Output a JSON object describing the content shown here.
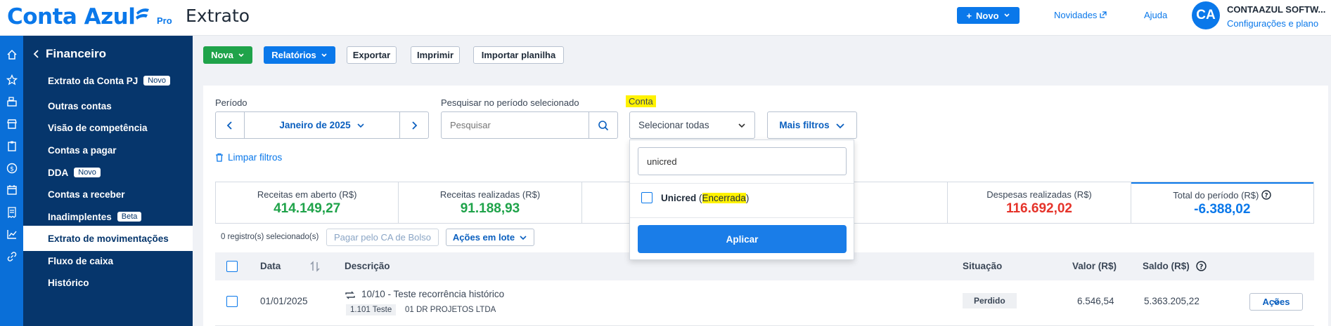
{
  "header": {
    "logo_text": "Conta Azul",
    "logo_badge": "Pro",
    "page_title": "Extrato",
    "new_button": "Novo",
    "news_link": "Novidades",
    "help_link": "Ajuda",
    "avatar_initials": "CA",
    "company_name": "CONTAAZUL SOFTW...",
    "settings_link": "Configurações e plano"
  },
  "sidebar": {
    "title": "Financeiro",
    "items": [
      {
        "label": "Extrato da Conta PJ",
        "badge": "Novo"
      },
      {
        "label": "Outras contas"
      },
      {
        "label": "Visão de competência"
      },
      {
        "label": "Contas a pagar"
      },
      {
        "label": "DDA",
        "badge": "Novo"
      },
      {
        "label": "Contas a receber"
      },
      {
        "label": "Inadimplentes",
        "badge": "Beta"
      },
      {
        "label": "Extrato de movimentações",
        "active": true
      },
      {
        "label": "Fluxo de caixa"
      },
      {
        "label": "Histórico"
      }
    ],
    "icons": [
      "home-icon",
      "star-icon",
      "cash-register-icon",
      "store-icon",
      "clipboard-icon",
      "dollar-icon",
      "calendar-icon",
      "receipt-icon",
      "chart-line-icon",
      "link-icon"
    ]
  },
  "toolbar": {
    "nova": "Nova",
    "relatorios": "Relatórios",
    "exportar": "Exportar",
    "imprimir": "Imprimir",
    "importar": "Importar planilha"
  },
  "filters": {
    "period_label": "Período",
    "period_value": "Janeiro de 2025",
    "search_label": "Pesquisar no período selecionado",
    "search_placeholder": "Pesquisar",
    "account_label": "Conta",
    "account_value": "Selecionar todas",
    "more_filters": "Mais filtros",
    "clear_filters": "Limpar filtros"
  },
  "dropdown": {
    "search_value": "unicred",
    "option_name": "Unicred",
    "option_paren_open": "(",
    "option_status": "Encerrada",
    "option_paren_close": ")",
    "apply": "Aplicar"
  },
  "summary": [
    {
      "label": "Receitas em aberto (R$)",
      "value": "414.149,27",
      "color": "#1fa34a"
    },
    {
      "label": "Receitas realizadas (R$)",
      "value": "91.188,93",
      "color": "#1fa34a"
    },
    {
      "label": "",
      "value": ""
    },
    {
      "label": "",
      "value": ""
    },
    {
      "label": "Despesas realizadas (R$)",
      "value": "116.692,02",
      "color": "#e5332a"
    },
    {
      "label": "Total do período (R$)",
      "value": "-6.388,02",
      "color": "#0a78ea"
    }
  ],
  "table_actions": {
    "selected_count": "0 registro(s) selecionado(s)",
    "pay_button": "Pagar pelo CA de Bolso",
    "batch_actions": "Ações em lote"
  },
  "table": {
    "columns": [
      "Data",
      "Descrição",
      "Situação",
      "Valor (R$)",
      "Saldo (R$)"
    ],
    "rows": [
      {
        "date": "01/01/2025",
        "description": "10/10 - Teste recorrência histórico",
        "category": "1.101 Teste",
        "contact": "01 DR PROJETOS LTDA",
        "status": "Perdido",
        "value": "6.546,54",
        "balance": "5.363.205,22",
        "actions": "Ações"
      }
    ]
  }
}
